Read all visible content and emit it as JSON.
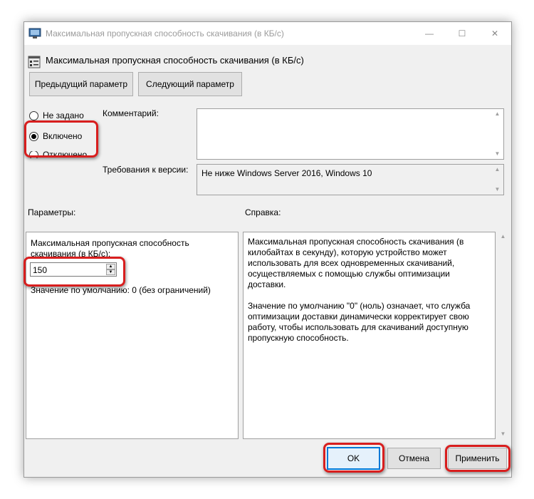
{
  "window": {
    "title": "Максимальная пропускная способность скачивания (в КБ/с)",
    "controls": {
      "minimize": "—",
      "maximize": "☐",
      "close": "✕"
    }
  },
  "header": {
    "title": "Максимальная пропускная способность скачивания (в КБ/с)"
  },
  "nav": {
    "prev_label": "Предыдущий параметр",
    "next_label": "Следующий параметр"
  },
  "state": {
    "options": [
      {
        "label": "Не задано",
        "checked": false
      },
      {
        "label": "Включено",
        "checked": true
      },
      {
        "label": "Отключено",
        "checked": false
      }
    ]
  },
  "comment": {
    "label": "Комментарий:",
    "value": ""
  },
  "requirements": {
    "label": "Требования к версии:",
    "value": "Не ниже Windows Server 2016, Windows 10"
  },
  "params": {
    "label": "Параметры:",
    "description": "Максимальная пропускная способность скачивания (в КБ/с):",
    "value": "150",
    "default_text": "Значение по умолчанию: 0 (без ограничений)"
  },
  "help": {
    "label": "Справка:",
    "paragraphs": [
      "Максимальная пропускная способность скачивания (в килобайтах в секунду), которую устройство может использовать для всех одновременных скачиваний, осуществляемых с помощью службы оптимизации доставки.",
      "Значение по умолчанию \"0\" (ноль) означает, что служба оптимизации доставки динамически корректирует свою работу, чтобы использовать для скачиваний доступную пропускную способность."
    ]
  },
  "footer": {
    "ok_label": "OK",
    "cancel_label": "Отмена",
    "apply_label": "Применить"
  },
  "colors": {
    "highlight": "#d81e1e",
    "focus_border": "#0078d7",
    "dialog_bg": "#f0f0f0"
  }
}
